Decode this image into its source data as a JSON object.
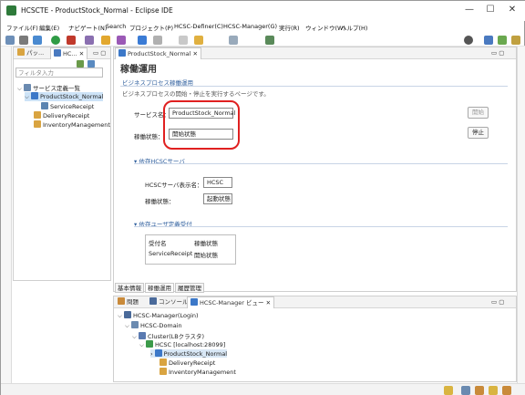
{
  "window": {
    "title": "HCSCTE - ProductStock_Normal - Eclipse IDE",
    "controls": {
      "minimize": "—",
      "maximize": "☐",
      "close": "✕"
    }
  },
  "menu": [
    "ファイル(F)",
    "編集(E)",
    "ナビゲート(N)",
    "Search",
    "プロジェクト(P)",
    "HCSC-Definer(C)",
    "HCSC-Manager(G)",
    "実行(R)",
    "ウィンドウ(W)",
    "ヘルプ(H)"
  ],
  "left_view": {
    "tabs": [
      "パッ...",
      "HC..."
    ],
    "filter_placeholder": "フィルタ入力",
    "tree": [
      {
        "label": "サービス定義一覧"
      },
      {
        "label": "ProductStock_Normal"
      },
      {
        "label": "ServiceReceipt"
      },
      {
        "label": "DeliveryReceipt"
      },
      {
        "label": "InventoryManagement"
      }
    ]
  },
  "editor": {
    "tab": "ProductStock_Normal",
    "title": "稼働運用",
    "section1": {
      "heading": "ビジネスプロセス稼働運用",
      "description": "ビジネスプロセスの開始・停止を実行するページです。",
      "service_name_label": "サービス名：",
      "service_name_value": "ProductStock_Normal",
      "status_label": "稼働状態：",
      "status_value": "開始状態",
      "start_button": "開始",
      "stop_button": "停止"
    },
    "section2": {
      "heading": "依存HCSCサーバ",
      "server_label": "HCSCサーバ表示名：",
      "server_value": "HCSC",
      "status_label": "稼働状態：",
      "status_value": "起動状態"
    },
    "section3": {
      "heading": "依存ユーザ定義受付",
      "columns": [
        "受付名",
        "稼働状態"
      ],
      "rows": [
        [
          "ServiceReceipt",
          "開始状態"
        ]
      ]
    },
    "bottom_tabs": [
      "基本情報",
      "稼働運用",
      "履歴管理"
    ]
  },
  "bottom_view": {
    "tabs": [
      "問題",
      "コンソール",
      "HCSC-Manager ビュー"
    ],
    "tree": [
      {
        "label": "HCSC-Manager(Login)"
      },
      {
        "label": "HCSC-Domain"
      },
      {
        "label": "Cluster(LBクラスタ)"
      },
      {
        "label": "HCSC [localhost:28099]"
      },
      {
        "label": "ProductStock_Normal"
      },
      {
        "label": "DeliveryReceipt"
      },
      {
        "label": "InventoryManagement"
      }
    ]
  },
  "colors": {
    "highlight": "#e02020",
    "section": "#2f5f9e"
  }
}
